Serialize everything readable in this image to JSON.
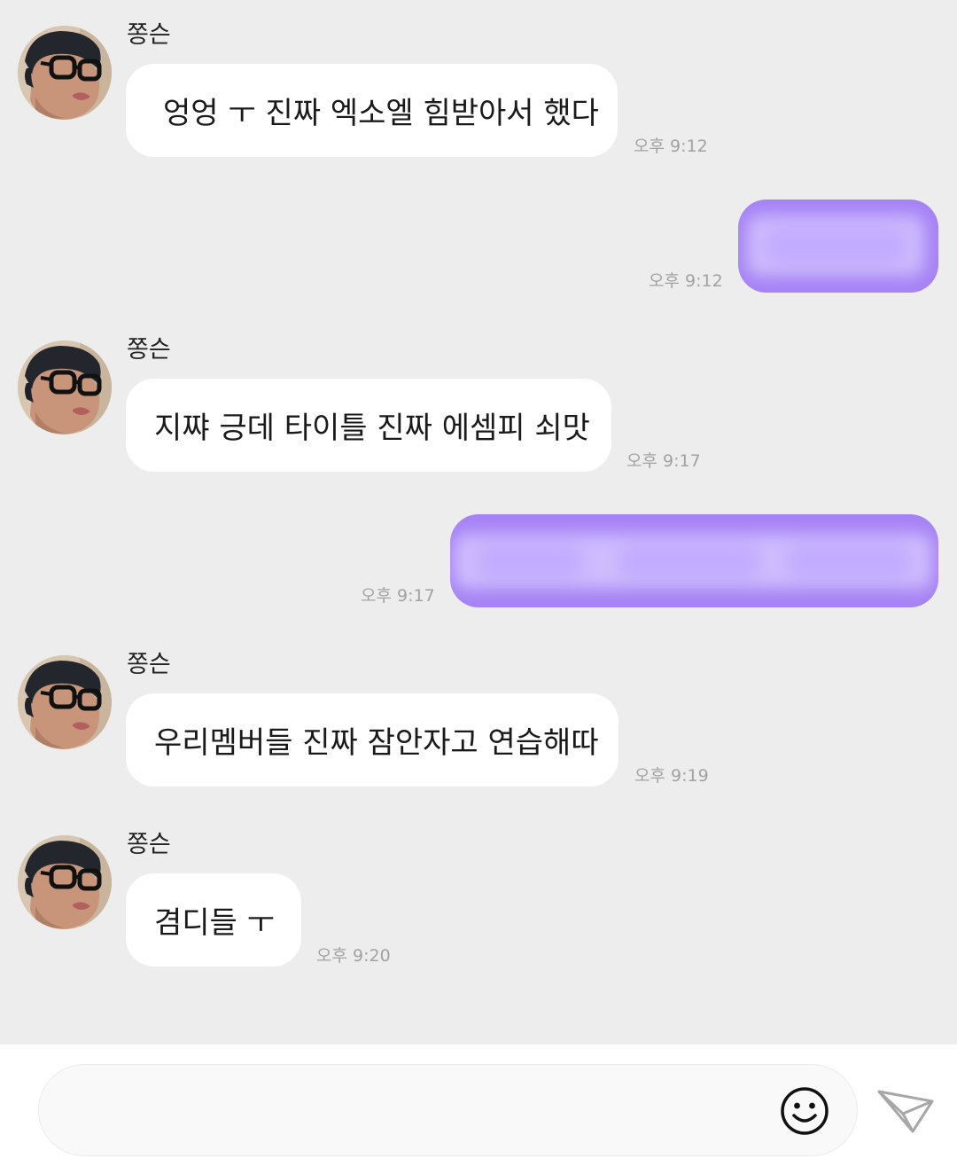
{
  "conversation": {
    "messages": [
      {
        "direction": "incoming",
        "sender": "쫑슨",
        "text": "엉엉 ㅜ 진짜 엑소엘 힘받아서 했다",
        "time": "오후 9:12"
      },
      {
        "direction": "outgoing",
        "text": "",
        "blurred": true,
        "time": "오후 9:12"
      },
      {
        "direction": "incoming",
        "sender": "쫑슨",
        "text": "지쨔 긍데 타이틀 진짜 에셈피 쇠맛",
        "time": "오후 9:17"
      },
      {
        "direction": "outgoing",
        "text": "",
        "blurred": true,
        "time": "오후 9:17"
      },
      {
        "direction": "incoming",
        "sender": "쫑슨",
        "text": "우리멤버들 진짜 잠안자고 연습해따",
        "time": "오후 9:19"
      },
      {
        "direction": "incoming",
        "sender": "쫑슨",
        "text": "겸디들 ㅜ",
        "time": "오후 9:20"
      }
    ]
  },
  "composer": {
    "value": "",
    "placeholder": "",
    "emoji_icon": "smiley-face-icon",
    "send_icon": "paper-plane-icon"
  },
  "colors": {
    "background": "#ededed",
    "incoming_bubble": "#ffffff",
    "outgoing_bubble": "#a683f5",
    "timestamp": "#a2a2a2"
  }
}
